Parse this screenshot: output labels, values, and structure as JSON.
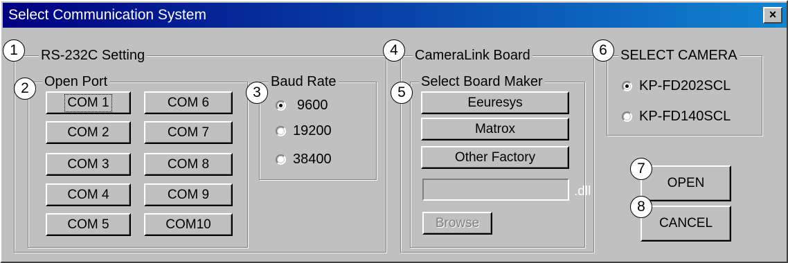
{
  "window": {
    "title": "Select Communication System",
    "close_glyph": "×"
  },
  "rs232": {
    "legend": "RS-232C Setting",
    "open_port": {
      "legend": "Open Port",
      "ports": [
        "COM 1",
        "COM 2",
        "COM 3",
        "COM 4",
        "COM 5",
        "COM 6",
        "COM 7",
        "COM 8",
        "COM 9",
        "COM10"
      ],
      "focused": "COM 1"
    },
    "baud": {
      "legend": "Baud Rate",
      "options": [
        "9600",
        "19200",
        "38400"
      ],
      "selected": "9600"
    }
  },
  "cameralink": {
    "legend": "CameraLink Board",
    "maker": {
      "legend": "Select Board Maker",
      "buttons": [
        "Eeuresys",
        "Matrox",
        "Other Factory"
      ],
      "dll_value": "",
      "dll_suffix": ".dll",
      "browse_label": "Browse"
    }
  },
  "camera": {
    "legend": "SELECT CAMERA",
    "options": [
      "KP-FD202SCL",
      "KP-FD140SCL"
    ],
    "selected": "KP-FD202SCL"
  },
  "actions": {
    "open_label": "OPEN",
    "cancel_label": "CANCEL"
  },
  "callouts": [
    "1",
    "2",
    "3",
    "4",
    "5",
    "6",
    "7",
    "8"
  ],
  "colors": {
    "face": "#c0c0c0",
    "title_start": "#000080",
    "title_end": "#1084d0"
  }
}
